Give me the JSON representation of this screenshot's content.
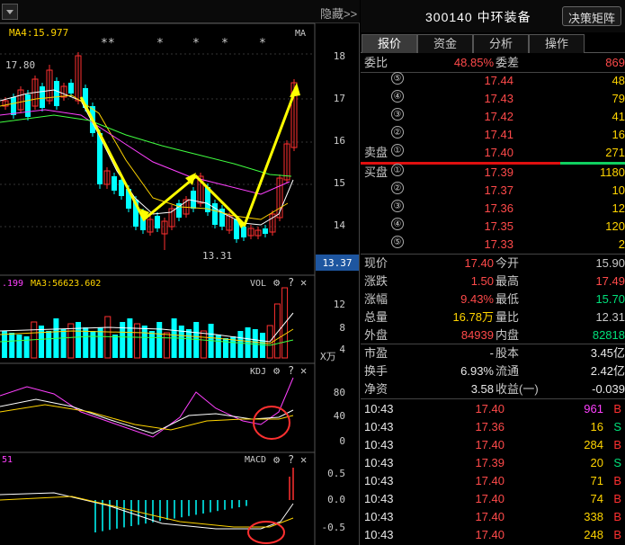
{
  "left": {
    "hide_label": "隐藏",
    "chevron": ">>",
    "ma4": "MA4:15.977",
    "ma_tag": "MA",
    "stars": [
      "**",
      "*",
      "*",
      "*",
      "*"
    ],
    "high_label": "17.80",
    "low_label": "13.31",
    "price_ticks": [
      "18",
      "17",
      "16",
      "15",
      "14"
    ],
    "current_price_tag": "13.37",
    "vol_left": ".199",
    "vol_ma3": "MA3:56623.602",
    "vol_tag": "VOL",
    "vol_ticks": [
      "12",
      "8",
      "4"
    ],
    "vol_unit": "X万",
    "kdj_tag": "KDJ",
    "kdj_ticks": [
      "80",
      "40",
      "0"
    ],
    "macd_left": "51",
    "macd_tag": "MACD",
    "macd_ticks": [
      "0.5",
      "0.0",
      "-0.5"
    ],
    "gear_icon": "⚙",
    "help_icon": "?",
    "close_icon": "✕"
  },
  "right": {
    "code_name": "300140 中环装备",
    "decision_btn": "决策矩阵",
    "tabs": [
      "报价",
      "资金",
      "分析",
      "操作"
    ],
    "weibi": {
      "l1": "委比",
      "v1": "48.85%",
      "l2": "委差",
      "v2": "869"
    },
    "asks": [
      {
        "lab": "",
        "n": "⑤",
        "p": "17.44",
        "v": "48"
      },
      {
        "lab": "",
        "n": "④",
        "p": "17.43",
        "v": "79"
      },
      {
        "lab": "",
        "n": "③",
        "p": "17.42",
        "v": "41"
      },
      {
        "lab": "",
        "n": "②",
        "p": "17.41",
        "v": "16"
      },
      {
        "lab": "卖盘",
        "n": "①",
        "p": "17.40",
        "v": "271"
      }
    ],
    "bids": [
      {
        "lab": "买盘",
        "n": "①",
        "p": "17.39",
        "v": "1180"
      },
      {
        "lab": "",
        "n": "②",
        "p": "17.37",
        "v": "10"
      },
      {
        "lab": "",
        "n": "③",
        "p": "17.36",
        "v": "12"
      },
      {
        "lab": "",
        "n": "④",
        "p": "17.35",
        "v": "120"
      },
      {
        "lab": "",
        "n": "⑤",
        "p": "17.33",
        "v": "2"
      }
    ],
    "stats": [
      {
        "l1": "现价",
        "v1": "17.40",
        "c1": "red",
        "l2": "今开",
        "v2": "15.90",
        "c2": "gray"
      },
      {
        "l1": "涨跌",
        "v1": "1.50",
        "c1": "red",
        "l2": "最高",
        "v2": "17.49",
        "c2": "red"
      },
      {
        "l1": "涨幅",
        "v1": "9.43%",
        "c1": "red",
        "l2": "最低",
        "v2": "15.70",
        "c2": "green"
      },
      {
        "l1": "总量",
        "v1": "16.78万",
        "c1": "yellow",
        "l2": "量比",
        "v2": "12.31",
        "c2": "gray"
      },
      {
        "l1": "外盘",
        "v1": "84939",
        "c1": "red",
        "l2": "内盘",
        "v2": "82818",
        "c2": "green"
      }
    ],
    "fin": [
      {
        "l1": "市盈",
        "v1": "-",
        "l2": "股本",
        "v2": "3.45亿"
      },
      {
        "l1": "换手",
        "v1": "6.93%",
        "l2": "流通",
        "v2": "2.42亿"
      },
      {
        "l1": "净资",
        "v1": "3.58",
        "l2": "收益(一)",
        "v2": "-0.039"
      }
    ],
    "ticks": [
      {
        "t": "10:43",
        "p": "17.40",
        "v": "961",
        "vc": "magenta",
        "s": "B"
      },
      {
        "t": "10:43",
        "p": "17.36",
        "v": "16",
        "vc": "yellow",
        "s": "S"
      },
      {
        "t": "10:43",
        "p": "17.40",
        "v": "284",
        "vc": "yellow",
        "s": "B"
      },
      {
        "t": "10:43",
        "p": "17.39",
        "v": "20",
        "vc": "yellow",
        "s": "S"
      },
      {
        "t": "10:43",
        "p": "17.40",
        "v": "71",
        "vc": "yellow",
        "s": "B"
      },
      {
        "t": "10:43",
        "p": "17.40",
        "v": "74",
        "vc": "yellow",
        "s": "B"
      },
      {
        "t": "10:43",
        "p": "17.40",
        "v": "338",
        "vc": "yellow",
        "s": "B"
      },
      {
        "t": "10:43",
        "p": "17.40",
        "v": "248",
        "vc": "yellow",
        "s": "B"
      }
    ]
  }
}
